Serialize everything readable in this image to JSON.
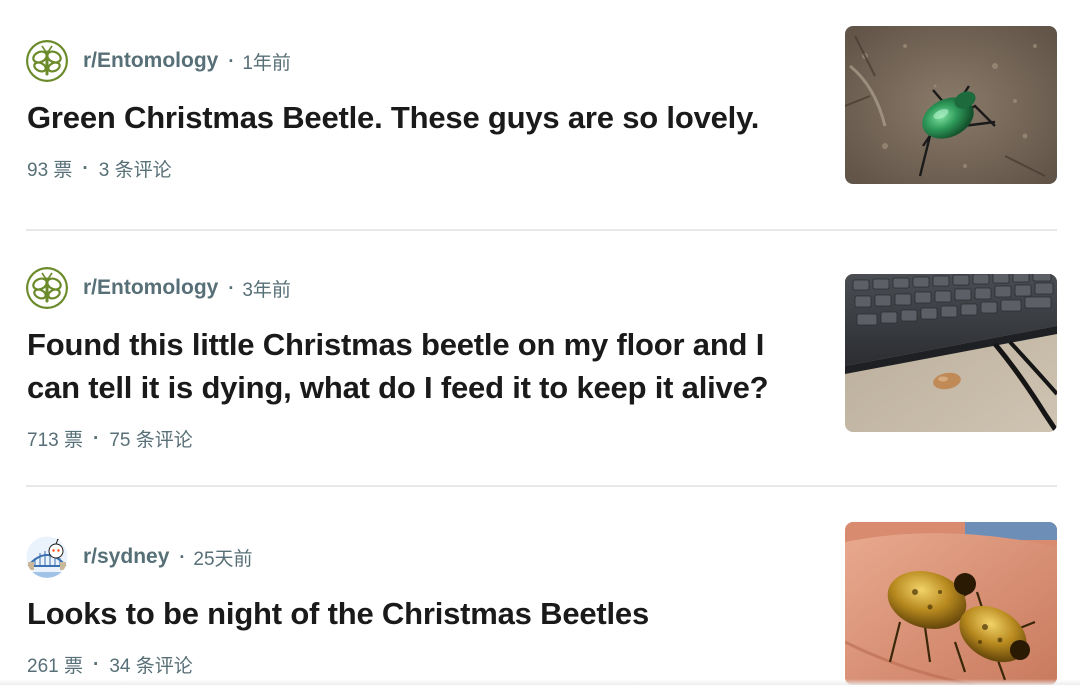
{
  "posts": [
    {
      "subreddit": "r/Entomology",
      "time": "1年前",
      "title": "Green Christmas Beetle. These guys are so lovely.",
      "votes": "93 票",
      "comments": "3 条评论",
      "avatar": "entomology-bug-icon",
      "thumbnail": "green-beetle-on-soil"
    },
    {
      "subreddit": "r/Entomology",
      "time": "3年前",
      "title": "Found this little Christmas beetle on my floor and I can tell it is dying, what do I feed it to keep it alive?",
      "votes": "713 票",
      "comments": "75 条评论",
      "avatar": "entomology-bug-icon",
      "thumbnail": "beetle-beside-keyboard"
    },
    {
      "subreddit": "r/sydney",
      "time": "25天前",
      "title": "Looks to be night of the Christmas Beetles",
      "votes": "261 票",
      "comments": "34 条评论",
      "avatar": "sydney-harbour-bridge-snoo-icon",
      "thumbnail": "two-beetles-on-finger"
    }
  ],
  "separator": "·",
  "colors": {
    "meta_text": "#576f76",
    "title_text": "#1a1a1b",
    "entomology_green": "#6b8a2a",
    "divider": "#e6e8ea"
  }
}
